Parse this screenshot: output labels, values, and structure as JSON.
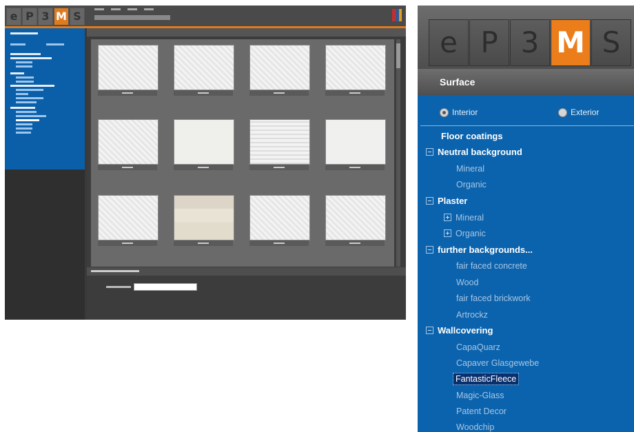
{
  "logo": {
    "letters": [
      "e",
      "P",
      "3",
      "M",
      "S"
    ],
    "accent_color": "#ec7d1b"
  },
  "sidebar": {
    "section_title": "Surface",
    "radios": [
      {
        "label": "Interior",
        "checked": true
      },
      {
        "label": "Exterior",
        "checked": false
      }
    ],
    "tree": {
      "floor_coatings": "Floor coatings",
      "neutral_background": "Neutral background",
      "neutral_mineral": "Mineral",
      "neutral_organic": "Organic",
      "plaster": "Plaster",
      "plaster_mineral": "Mineral",
      "plaster_organic": "Organic",
      "further_backgrounds": "further backgrounds...",
      "fair_faced_concrete": "fair faced concrete",
      "wood": "Wood",
      "fair_faced_brickwork": "fair faced brickwork",
      "artrockz": "Artrockz",
      "wallcovering": "Wallcovering",
      "capaquarz": "CapaQuarz",
      "capaver": "Capaver Glasgewebe",
      "fantastic_fleece": "FantasticFleece",
      "magic_glass": "Magic-Glass",
      "patent_decor": "Patent Decor",
      "woodchip": "Woodchip"
    },
    "selected_item": "FantasticFleece",
    "panel_color": "#0b63ad"
  }
}
